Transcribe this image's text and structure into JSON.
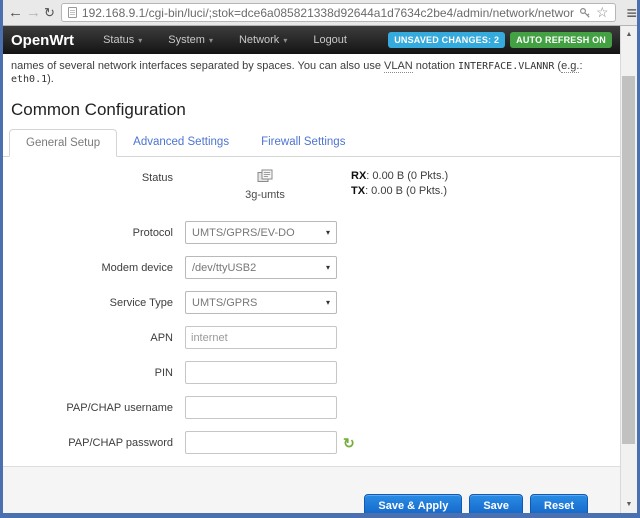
{
  "browser": {
    "url": "192.168.9.1/cgi-bin/luci/;stok=dce6a085821338d92644a1d7634c2be4/admin/network/networ"
  },
  "icons": {
    "back": "←",
    "forward": "→",
    "reload": "↻",
    "bookmark_star": "☆",
    "menu": "≡",
    "caret_down": "▾",
    "scroll_up": "▲",
    "scroll_down": "▼",
    "password_reveal": "↻"
  },
  "navbar": {
    "brand": "OpenWrt",
    "items": [
      {
        "label": "Status"
      },
      {
        "label": "System"
      },
      {
        "label": "Network"
      },
      {
        "label": "Logout"
      }
    ],
    "badges": [
      {
        "label": "UNSAVED CHANGES: 2",
        "color": "#35aadc"
      },
      {
        "label": "AUTO REFRESH ON",
        "color": "#43a143"
      }
    ]
  },
  "intro": {
    "part1": "names of several network interfaces separated by spaces. You can also use ",
    "abbr_vlan": "VLAN",
    "part2": " notation ",
    "code_notation": "INTERFACE.VLANNR",
    "part3": " (",
    "abbr_eg": "e.g.",
    "part4": ": ",
    "code_example": "eth0.1",
    "part5": ")."
  },
  "page": {
    "section_title": "Common Configuration"
  },
  "tabs": [
    {
      "label": "General Setup",
      "active": true
    },
    {
      "label": "Advanced Settings",
      "active": false
    },
    {
      "label": "Firewall Settings",
      "active": false
    }
  ],
  "form": {
    "status": {
      "label": "Status",
      "interface_name": "3g-umts",
      "rx_label": "RX",
      "rx_value": ": 0.00 B (0 Pkts.)",
      "tx_label": "TX",
      "tx_value": ": 0.00 B (0 Pkts.)"
    },
    "selects": [
      {
        "label": "Protocol",
        "value": "UMTS/GPRS/EV-DO"
      },
      {
        "label": "Modem device",
        "value": "/dev/ttyUSB2"
      },
      {
        "label": "Service Type",
        "value": "UMTS/GPRS"
      }
    ],
    "inputs": [
      {
        "label": "APN",
        "value": "internet"
      },
      {
        "label": "PIN",
        "value": ""
      },
      {
        "label": "PAP/CHAP username",
        "value": ""
      },
      {
        "label": "PAP/CHAP password",
        "value": ""
      }
    ]
  },
  "footer": {
    "buttons": [
      {
        "label": "Save & Apply"
      },
      {
        "label": "Save"
      },
      {
        "label": "Reset"
      }
    ]
  }
}
